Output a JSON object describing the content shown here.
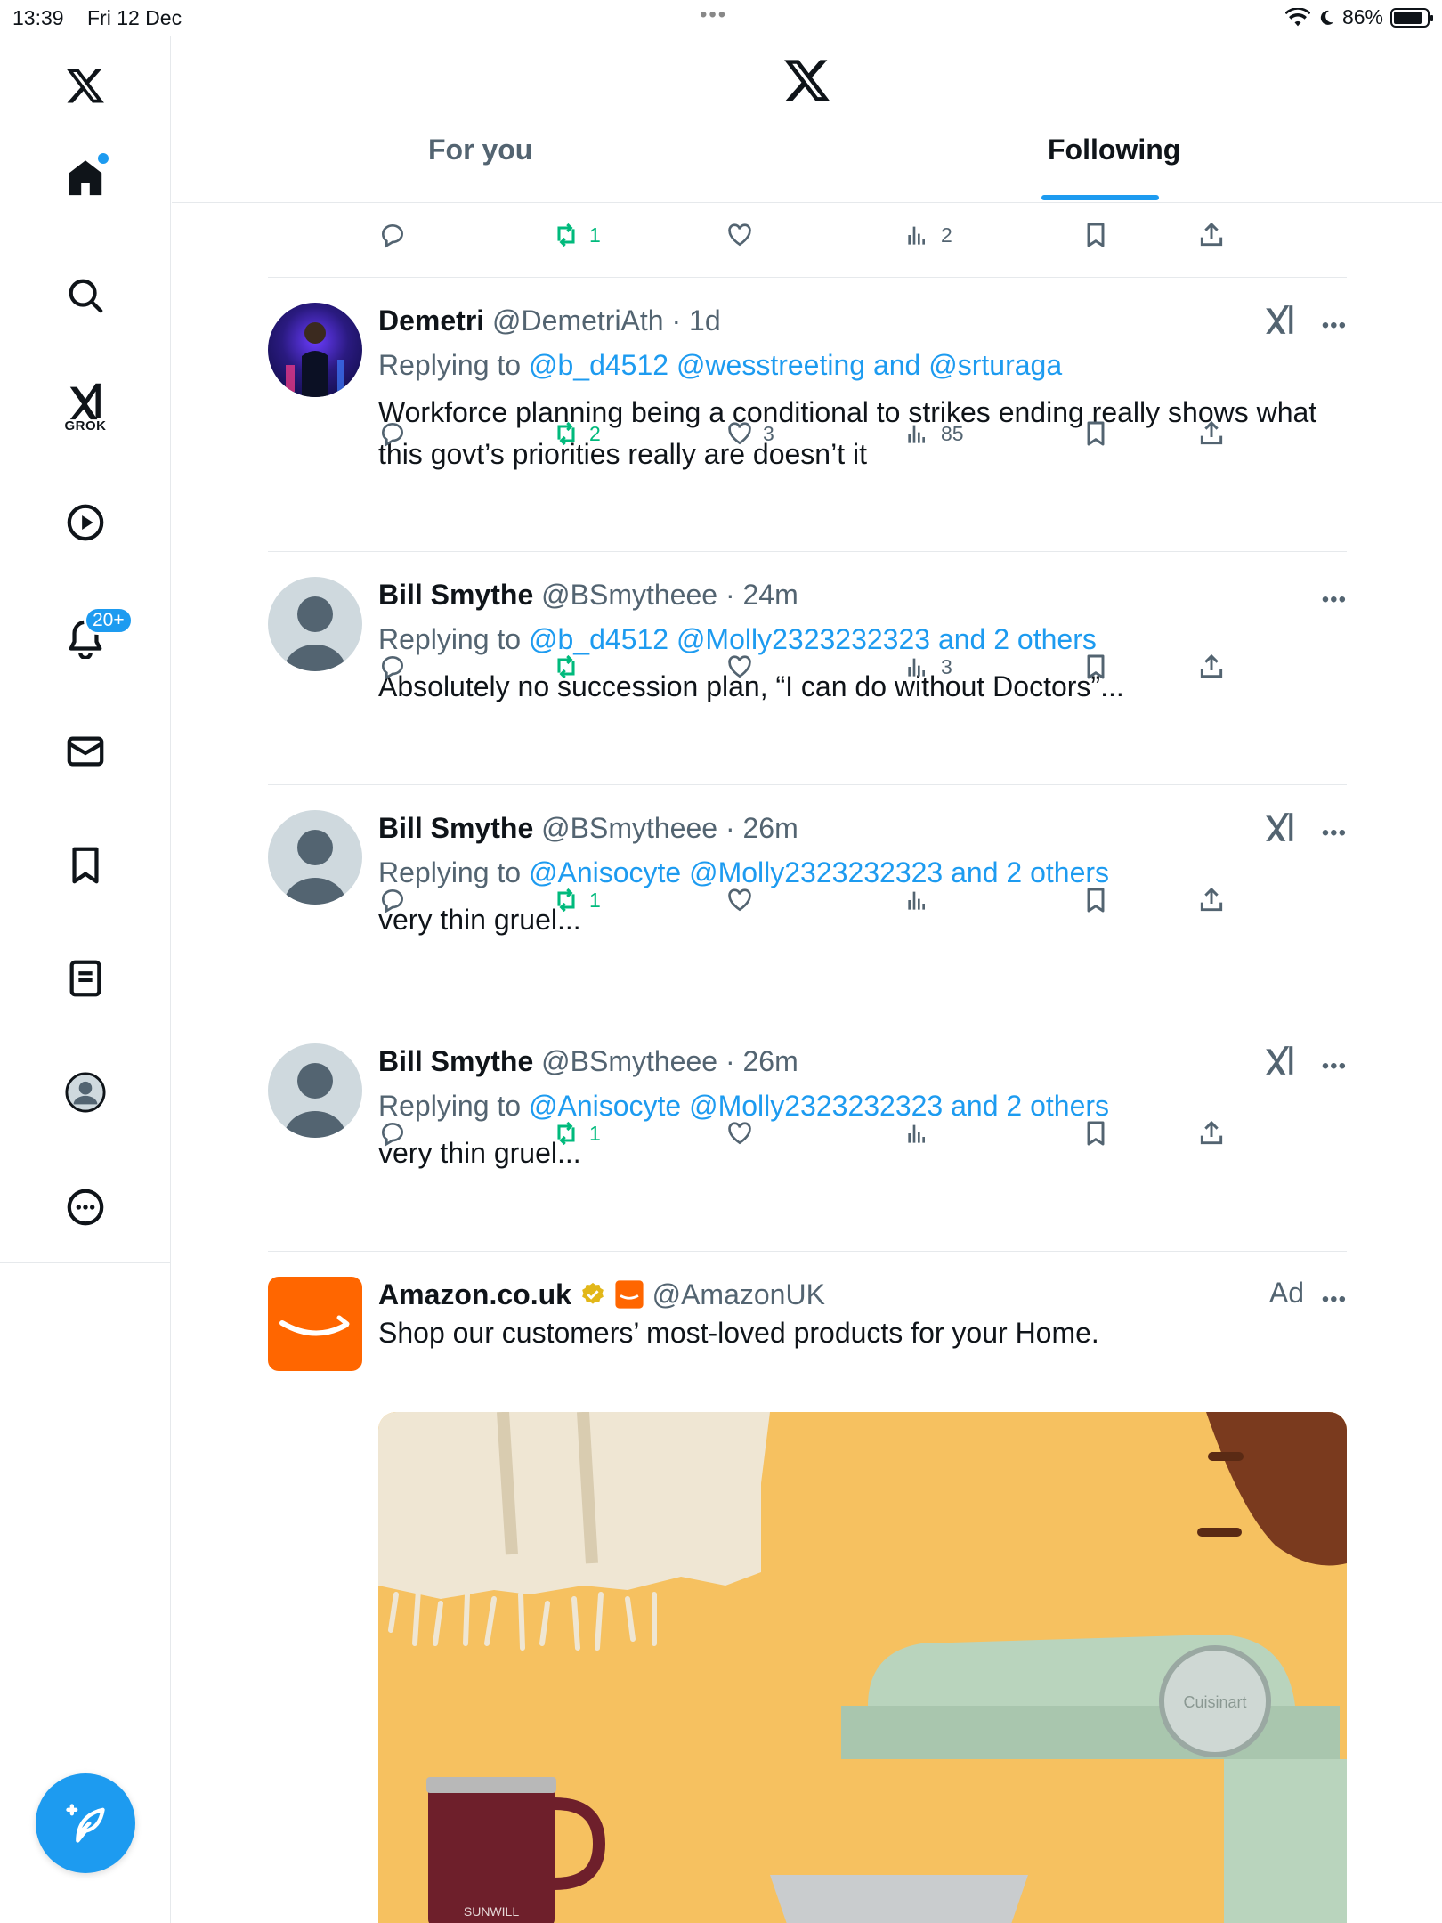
{
  "status": {
    "time": "13:39",
    "date": "Fri 12 Dec",
    "battery": "86%"
  },
  "sidebar": {
    "notifications_badge": "20+",
    "grok_label": "GROK"
  },
  "tabs": [
    {
      "label": "For you"
    },
    {
      "label": "Following"
    }
  ],
  "prev_post_actions": {
    "reposts": "1",
    "views": "2"
  },
  "posts": [
    {
      "name": "Demetri",
      "handle": "@DemetriAth",
      "time": "1d",
      "replying_prefix": "Replying to",
      "replying_links": "@b_d4512 @wesstreeting and @srturaga",
      "text": "Workforce planning being a conditional to strikes ending really shows what this govt’s priorities really are doesn’t it",
      "reposts": "2",
      "likes": "3",
      "views": "85"
    },
    {
      "name": "Bill Smythe",
      "handle": "@BSmytheee",
      "time": "24m",
      "replying_prefix": "Replying to",
      "replying_links": "@b_d4512 @Molly2323232323 and 2 others",
      "text": "Absolutely no succession plan, “I can do without Doctors”...",
      "reposts": "",
      "likes": "",
      "views": "3"
    },
    {
      "name": "Bill Smythe",
      "handle": "@BSmytheee",
      "time": "26m",
      "replying_prefix": "Replying to",
      "replying_links": "@Anisocyte @Molly2323232323 and 2 others",
      "text": "very thin gruel...",
      "reposts": "1",
      "likes": "",
      "views": ""
    },
    {
      "name": "Bill Smythe",
      "handle": "@BSmytheee",
      "time": "26m",
      "replying_prefix": "Replying to",
      "replying_links": "@Anisocyte @Molly2323232323 and 2 others",
      "text": "very thin gruel...",
      "reposts": "1",
      "likes": "",
      "views": ""
    }
  ],
  "ad": {
    "name": "Amazon.co.uk",
    "handle": "@AmazonUK",
    "label": "Ad",
    "text": "Shop our customers’ most-loved products for your Home.",
    "image_brand_mixer": "Cuisinart",
    "image_brand_mug": "SUNWILL"
  },
  "colors": {
    "accent": "#1d9bf0",
    "repost_green": "#00ba7c",
    "amazon_orange": "#ff6600"
  }
}
